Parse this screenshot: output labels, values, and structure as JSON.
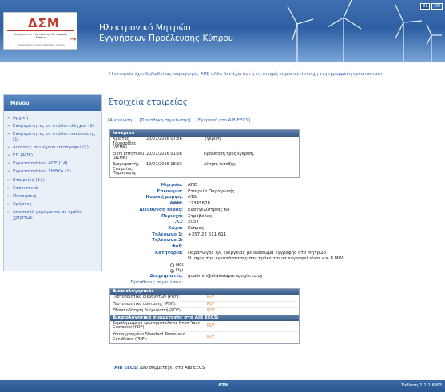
{
  "header": {
    "logo_mark": "ΔΣΜ",
    "logo_line1": "Διαχειριστής Συστήματος Μεταφοράς Κύπρου",
    "logo_line2": "Transmission System Operator - Cyprus",
    "title_line1": "Ηλεκτρονικό Μητρώο",
    "title_line2": "Εγγυήσεων Προέλευσης Κύπρου",
    "langs": [
      "EL",
      "EN"
    ]
  },
  "notice": "Η εταιρεία έχει δηλωθεί ως παραγωγός ΑΠΕ αλλά δεν έχει αυτή τη στιγμή καμία αντίστοιχη εγγεγραμμένη εγκατάσταση",
  "sidebar": {
    "title": "Μενού",
    "items": [
      "Αρχική",
      "Εκκρεμότητες σε στάδιο ελέγχου (2)",
      "Εκκρεμότητες σε στάδιο επικύρωσης (1)",
      "Αιτήσεις που έχουν επιστραφεί (1)",
      "ΕΠ (ΑΠΕ)",
      "Εγκαταστάσεις ΑΠΕ (14)",
      "Εγκαταστάσεις ΣΗΘΥΑ (1)",
      "Εταιρείες (12)",
      "Στατιστικά",
      "Μετρήσεις",
      "Χρήστες",
      "Αποστολή μηνύματος σε ομάδα χρηστών"
    ]
  },
  "main": {
    "page_title": "Στοιχεία εταιρείας",
    "tabs": [
      "[Ανανέωση]",
      "[Προσθήκη σημείωσης]",
      "[Εγγραφή στο AIB EECS]"
    ]
  },
  "history": {
    "title": "Ιστορικό",
    "rows": [
      {
        "who": "Χρίστος Τουφαρίδης (ΔΣΜΚ)",
        "when": "20/07/2016 07:56",
        "action": "Έγκριση."
      },
      {
        "who": "Eleni Efthymiou (ΔΣΜΚ)",
        "when": "20/07/2016 01:08",
        "action": "Προώθηση προς έγκριση."
      },
      {
        "who": "Διαχειριστής Εταιρείας Παραγωγής",
        "when": "19/07/2016 18:03",
        "action": "Αίτηση ένταξης."
      }
    ]
  },
  "details": {
    "registry_label": "Μητρώο:",
    "registry": "ΑΠΕ",
    "name_label": "Επωνυμία:",
    "name": "Εταιρεία Παραγωγής",
    "legal_label": "Νομική μορφή:",
    "legal": "ΛΤΔ",
    "afm_label": "ΑΦΜ:",
    "afm": "12345678",
    "address_label": "Διεύθυνση έδρας:",
    "address": "Ευαγγελίστριας 68",
    "region_label": "Περιοχή:",
    "region": "Στρόβολος",
    "tk_label": "Τ.Κ.:",
    "tk": "2057",
    "country_label": "Χώρα:",
    "country": "Κύπρος",
    "phone1_label": "Τηλέφωνο 1:",
    "phone1": "+357 22 611 611",
    "phone2_label": "Τηλέφωνο 2:",
    "fax_label": "Φαξ:",
    "category_label": "Κατηγορία:",
    "category_line1": "Παραγωγός ηλ. ενέργειας με δικαίωμα εγγραφής στο Μητρώο",
    "category_line2": "Η ισχύς της εγκατάστασης που πρόκειται να εγγραφεί είναι <= 8 MW:",
    "yes": "Ναι",
    "no": "Όχι",
    "admin_label": "Διαχειριστές:",
    "admin": "goadmin@etaireiaparagogis.co.cy",
    "notes_link": "Προσθετες σημειώσεις:"
  },
  "docs": {
    "title": "Δικαιολογητικά:",
    "items": [
      "Πιστοποιητικό διευθυντών (PDF):",
      "Πιστοποιητικό σύστασης (PDF):",
      "Εξουσιοδότηση διαχειριστή (PDF):"
    ],
    "aib_title": "Δικαιολογητικά συμμετοχής στο AIB EECS:",
    "aib_items": [
      "Συμπληρωμένο ερωτηματολόγιο Know-Your-Customer (PDF):",
      "Υπογεγραμμένο Standard Terms and Conditions (PDF):"
    ],
    "pdf": "PDF"
  },
  "aib": {
    "label": "AIB EECS:",
    "value": "Δεν συμμετέχει στο AIB EECS"
  },
  "footer": {
    "org": "ΔΣΜ",
    "version": "Έκδοση 2.2.1.6/63"
  }
}
